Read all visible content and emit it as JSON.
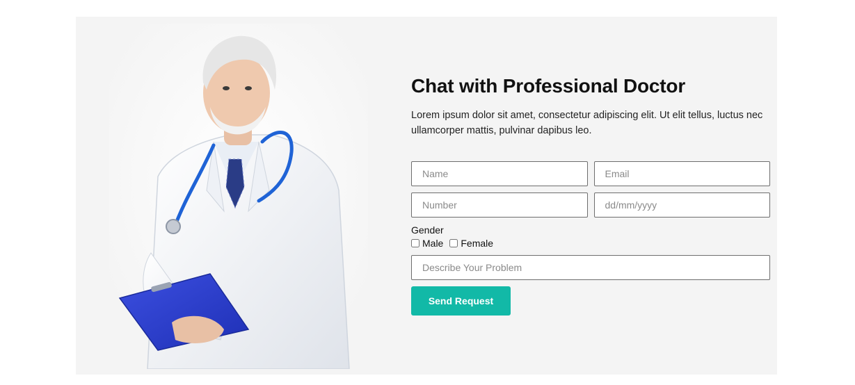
{
  "hero": {
    "title": "Chat with Professional Doctor",
    "description": "Lorem ipsum dolor sit amet, consectetur adipiscing elit. Ut elit tellus, luctus nec ullamcorper mattis, pulvinar dapibus leo."
  },
  "form": {
    "name_placeholder": "Name",
    "email_placeholder": "Email",
    "number_placeholder": "Number",
    "date_placeholder": "dd/mm/yyyy",
    "gender_label": "Gender",
    "gender_options": [
      "Male",
      "Female"
    ],
    "problem_placeholder": "Describe Your Problem",
    "submit_label": "Send Request"
  },
  "colors": {
    "section_bg": "#f4f4f4",
    "button_bg": "#12b9a7",
    "button_text": "#ffffff",
    "field_border": "#6d6d6d"
  },
  "icons": {
    "doctor_photo": "doctor-illustration"
  }
}
